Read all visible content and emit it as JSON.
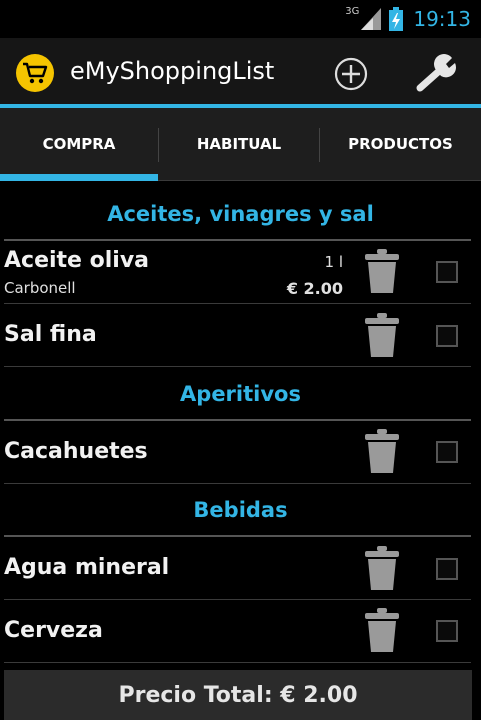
{
  "status_bar": {
    "network": "3G",
    "time": "19:13"
  },
  "app": {
    "title": "eMyShoppingList",
    "icon": "shopping-cart-icon",
    "accent": "#33b5e5",
    "icon_color": "#f5c400"
  },
  "tabs": [
    {
      "label": "COMPRA",
      "selected": true
    },
    {
      "label": "HABITUAL",
      "selected": false
    },
    {
      "label": "PRODUCTOS",
      "selected": false
    }
  ],
  "sections": [
    {
      "title": "Aceites, vinagres y sal",
      "items": [
        {
          "name": "Aceite oliva",
          "brand": "Carbonell",
          "quantity": "1 l",
          "price": "€ 2.00",
          "checked": false
        },
        {
          "name": "Sal fina",
          "checked": false
        }
      ]
    },
    {
      "title": "Aperitivos",
      "items": [
        {
          "name": "Cacahuetes",
          "checked": false
        }
      ]
    },
    {
      "title": "Bebidas",
      "items": [
        {
          "name": "Agua mineral",
          "checked": false
        },
        {
          "name": "Cerveza",
          "checked": false
        }
      ]
    }
  ],
  "footer": {
    "total_label": "Precio Total: € 2.00"
  }
}
